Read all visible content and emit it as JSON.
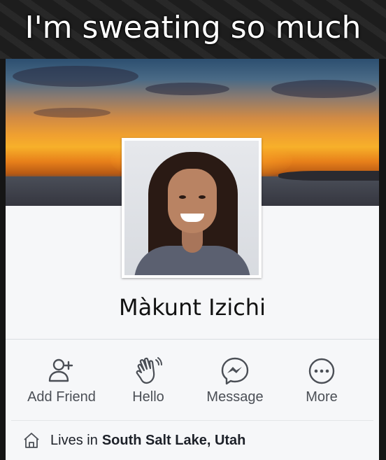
{
  "meme": {
    "caption": "I'm sweating so much"
  },
  "profile": {
    "name": "Màkunt Izichi"
  },
  "actions": [
    {
      "label": "Add Friend",
      "icon": "add-friend-icon"
    },
    {
      "label": "Hello",
      "icon": "waving-hand-icon"
    },
    {
      "label": "Message",
      "icon": "messenger-icon"
    },
    {
      "label": "More",
      "icon": "more-icon"
    }
  ],
  "about": {
    "lives_prefix": "Lives in",
    "place": "South Salt Lake, Utah",
    "icon": "home-icon"
  },
  "colors": {
    "card_background": "#f6f7f9",
    "icon_color": "#4b4f56",
    "meme_background": "#1d1d1d"
  }
}
